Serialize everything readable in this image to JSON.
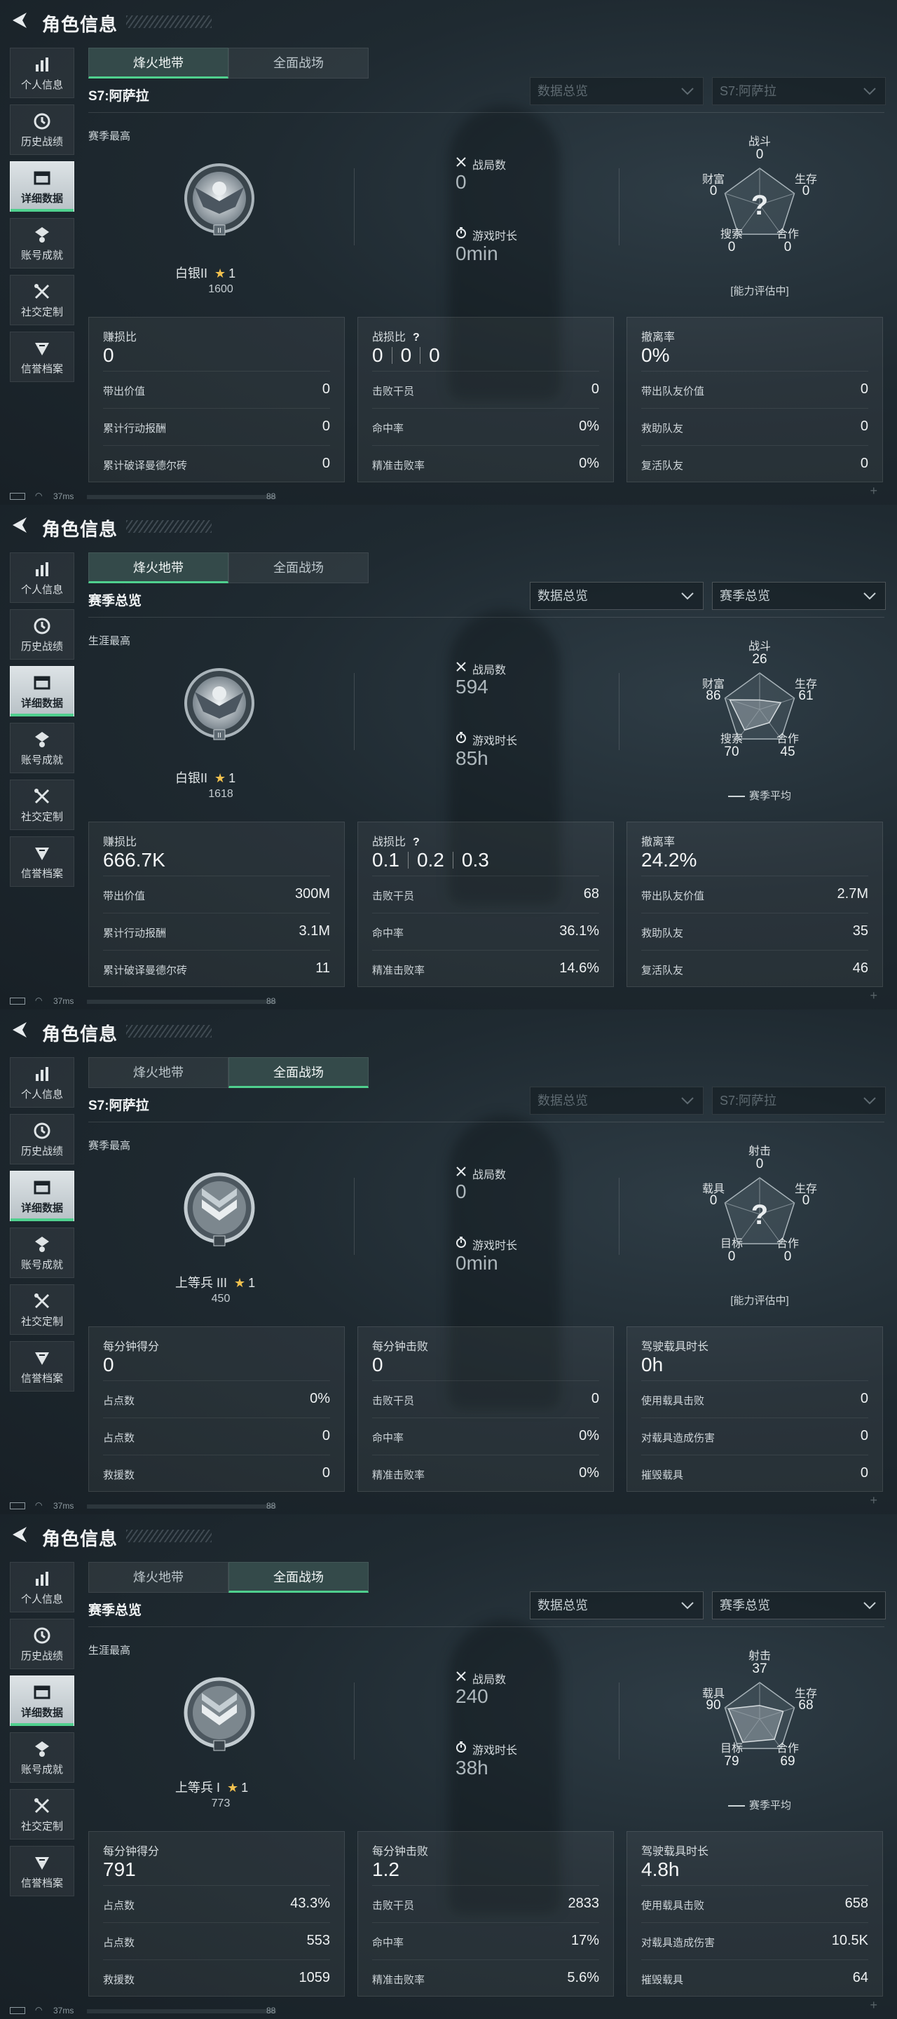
{
  "screens": [
    {
      "header": {
        "title": "角色信息"
      },
      "sidebar": [
        "个人信息",
        "历史战绩",
        "详细数据",
        "账号成就",
        "社交定制",
        "信誉档案"
      ],
      "active_side": 2,
      "tabs": [
        "烽火地带",
        "全面战场"
      ],
      "active_tab": 0,
      "sub_title": "S7:阿萨拉",
      "dropdowns": [
        "数据总览",
        "S7:阿萨拉"
      ],
      "dropdowns_dim": true,
      "section_label": "赛季最高",
      "rank": {
        "name": "白银II",
        "stars": "1",
        "score": "1600",
        "badge": "silver"
      },
      "battles_label": "战局数",
      "battles": "0",
      "time_label": "游戏时长",
      "time": "0min",
      "radar": {
        "labels": [
          "战斗",
          "生存",
          "合作",
          "搜索",
          "财富"
        ],
        "values": [
          "0",
          "0",
          "0",
          "0",
          "0"
        ],
        "data": [
          0,
          0,
          0,
          0,
          0
        ],
        "unknown": true,
        "note": "[能力评估中]"
      },
      "cards": [
        {
          "head": "赚损比",
          "big": [
            "0"
          ],
          "rows": [
            [
              "带出价值",
              "0"
            ],
            [
              "累计行动报酬",
              "0"
            ],
            [
              "累计破译曼德尔砖",
              "0"
            ]
          ]
        },
        {
          "head": "战损比",
          "q": "?",
          "big": [
            "0",
            "0",
            "0"
          ],
          "rows": [
            [
              "击败干员",
              "0"
            ],
            [
              "命中率",
              "0%"
            ],
            [
              "精准击败率",
              "0%"
            ]
          ]
        },
        {
          "head": "撤离率",
          "big": [
            "0%"
          ],
          "rows": [
            [
              "带出队友价值",
              "0"
            ],
            [
              "救助队友",
              "0"
            ],
            [
              "复活队友",
              "0"
            ]
          ]
        }
      ]
    },
    {
      "header": {
        "title": "角色信息"
      },
      "sidebar": [
        "个人信息",
        "历史战绩",
        "详细数据",
        "账号成就",
        "社交定制",
        "信誉档案"
      ],
      "active_side": 2,
      "tabs": [
        "烽火地带",
        "全面战场"
      ],
      "active_tab": 0,
      "sub_title": "赛季总览",
      "dropdowns": [
        "数据总览",
        "赛季总览"
      ],
      "dropdowns_dim": false,
      "section_label": "生涯最高",
      "rank": {
        "name": "白银II",
        "stars": "1",
        "score": "1618",
        "badge": "silver"
      },
      "battles_label": "战局数",
      "battles": "594",
      "time_label": "游戏时长",
      "time": "85h",
      "radar": {
        "labels": [
          "战斗",
          "生存",
          "合作",
          "搜索",
          "财富"
        ],
        "values": [
          "26",
          "61",
          "45",
          "70",
          "86"
        ],
        "data": [
          26,
          61,
          45,
          70,
          86
        ],
        "unknown": false,
        "note": "赛季平均"
      },
      "cards": [
        {
          "head": "赚损比",
          "big": [
            "666.7K"
          ],
          "rows": [
            [
              "带出价值",
              "300M"
            ],
            [
              "累计行动报酬",
              "3.1M"
            ],
            [
              "累计破译曼德尔砖",
              "11"
            ]
          ]
        },
        {
          "head": "战损比",
          "q": "?",
          "big": [
            "0.1",
            "0.2",
            "0.3"
          ],
          "rows": [
            [
              "击败干员",
              "68"
            ],
            [
              "命中率",
              "36.1%"
            ],
            [
              "精准击败率",
              "14.6%"
            ]
          ]
        },
        {
          "head": "撤离率",
          "big": [
            "24.2%"
          ],
          "rows": [
            [
              "带出队友价值",
              "2.7M"
            ],
            [
              "救助队友",
              "35"
            ],
            [
              "复活队友",
              "46"
            ]
          ]
        }
      ]
    },
    {
      "header": {
        "title": "角色信息"
      },
      "sidebar": [
        "个人信息",
        "历史战绩",
        "详细数据",
        "账号成就",
        "社交定制",
        "信誉档案"
      ],
      "active_side": 2,
      "tabs": [
        "烽火地带",
        "全面战场"
      ],
      "active_tab": 1,
      "sub_title": "S7:阿萨拉",
      "dropdowns": [
        "数据总览",
        "S7:阿萨拉"
      ],
      "dropdowns_dim": true,
      "section_label": "赛季最高",
      "rank": {
        "name": "上等兵 III",
        "stars": "1",
        "score": "450",
        "badge": "chevron"
      },
      "battles_label": "战局数",
      "battles": "0",
      "time_label": "游戏时长",
      "time": "0min",
      "radar": {
        "labels": [
          "射击",
          "生存",
          "合作",
          "目标",
          "载具"
        ],
        "values": [
          "0",
          "0",
          "0",
          "0",
          "0"
        ],
        "data": [
          0,
          0,
          0,
          0,
          0
        ],
        "unknown": true,
        "note": "[能力评估中]"
      },
      "cards": [
        {
          "head": "每分钟得分",
          "big": [
            "0"
          ],
          "rows": [
            [
              "占点数",
              "0%"
            ],
            [
              "占点数",
              "0"
            ],
            [
              "救援数",
              "0"
            ]
          ]
        },
        {
          "head": "每分钟击败",
          "big": [
            "0"
          ],
          "rows": [
            [
              "击败干员",
              "0"
            ],
            [
              "命中率",
              "0%"
            ],
            [
              "精准击败率",
              "0%"
            ]
          ]
        },
        {
          "head": "驾驶载具时长",
          "big": [
            "0h"
          ],
          "rows": [
            [
              "使用载具击败",
              "0"
            ],
            [
              "对载具造成伤害",
              "0"
            ],
            [
              "摧毁载具",
              "0"
            ]
          ]
        }
      ]
    },
    {
      "header": {
        "title": "角色信息"
      },
      "sidebar": [
        "个人信息",
        "历史战绩",
        "详细数据",
        "账号成就",
        "社交定制",
        "信誉档案"
      ],
      "active_side": 2,
      "tabs": [
        "烽火地带",
        "全面战场"
      ],
      "active_tab": 1,
      "sub_title": "赛季总览",
      "dropdowns": [
        "数据总览",
        "赛季总览"
      ],
      "dropdowns_dim": false,
      "section_label": "生涯最高",
      "rank": {
        "name": "上等兵 I",
        "stars": "1",
        "score": "773",
        "badge": "chevron"
      },
      "battles_label": "战局数",
      "battles": "240",
      "time_label": "游戏时长",
      "time": "38h",
      "radar": {
        "labels": [
          "射击",
          "生存",
          "合作",
          "目标",
          "载具"
        ],
        "values": [
          "37",
          "68",
          "69",
          "79",
          "90"
        ],
        "data": [
          37,
          68,
          69,
          79,
          90
        ],
        "unknown": false,
        "note": "赛季平均"
      },
      "cards": [
        {
          "head": "每分钟得分",
          "big": [
            "791"
          ],
          "rows": [
            [
              "占点数",
              "43.3%"
            ],
            [
              "占点数",
              "553"
            ],
            [
              "救援数",
              "1059"
            ]
          ]
        },
        {
          "head": "每分钟击败",
          "big": [
            "1.2"
          ],
          "rows": [
            [
              "击败干员",
              "2833"
            ],
            [
              "命中率",
              "17%"
            ],
            [
              "精准击败率",
              "5.6%"
            ]
          ]
        },
        {
          "head": "驾驶载具时长",
          "big": [
            "4.8h"
          ],
          "rows": [
            [
              "使用载具击败",
              "658"
            ],
            [
              "对载具造成伤害",
              "10.5K"
            ],
            [
              "摧毁载具",
              "64"
            ]
          ]
        }
      ]
    }
  ],
  "status": {
    "ping": "37ms",
    "right": "88"
  },
  "colors": {
    "accent_green": "#4fd08e",
    "star": "#f2c14e",
    "tab_active_bg": "#344a4a"
  },
  "icons": {
    "back": "back-arrow-icon",
    "battles": "crossed-swords-icon",
    "time": "stopwatch-icon",
    "dropdown": "chevron-down-icon"
  }
}
